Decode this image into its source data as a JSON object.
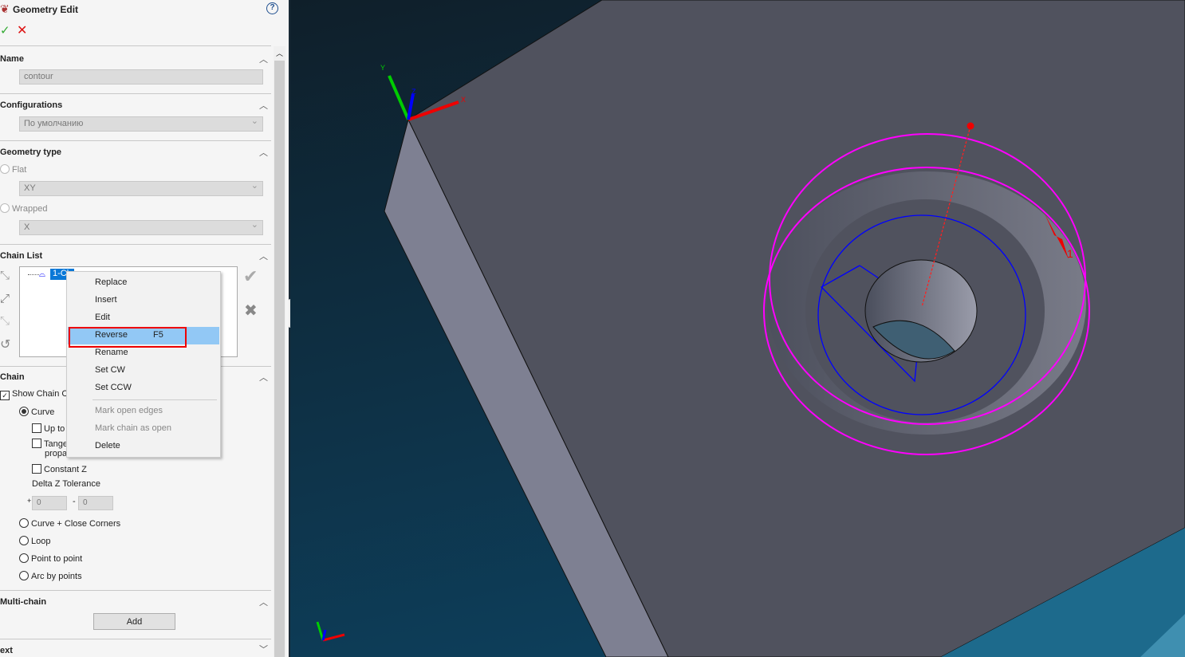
{
  "panel": {
    "title": "Geometry Edit",
    "help_icon": "question-icon",
    "name_section": {
      "label": "Name",
      "value": "contour"
    },
    "configurations": {
      "label": "Configurations",
      "value": "По умолчанию"
    },
    "geometry_type": {
      "label": "Geometry type",
      "flat": "Flat",
      "flat_plane": "XY",
      "wrapped": "Wrapped",
      "wrapped_axis": "X"
    },
    "chain_list": {
      "label": "Chain List",
      "item": "1-Ch"
    },
    "chain": {
      "label": "Chain",
      "show_chain": "Show Chain C",
      "curve": "Curve",
      "up_to": "Up to",
      "tangent": "Tange",
      "propagate": "propa",
      "constant_z": "Constant Z",
      "delta_z": "Delta Z Tolerance",
      "plus_value": "0",
      "minus_value": "0",
      "plus_sign": "+",
      "minus_sign": "-",
      "curve_close": "Curve + Close Corners",
      "loop": "Loop",
      "point_to_point": "Point to point",
      "arc_by_points": "Arc by points"
    },
    "multi_chain": {
      "label": "Multi-chain",
      "add": "Add"
    },
    "text_section": {
      "label": "ext"
    }
  },
  "context_menu": {
    "items": [
      {
        "label": "Replace"
      },
      {
        "label": "Insert"
      },
      {
        "label": "Edit"
      },
      {
        "label": "Reverse",
        "shortcut": "F5",
        "highlighted": true
      },
      {
        "label": "Rename"
      },
      {
        "label": "Set CW"
      },
      {
        "label": "Set CCW"
      },
      {
        "label": "Mark open edges",
        "disabled": true
      },
      {
        "label": "Mark chain as open",
        "disabled": true
      },
      {
        "label": "Delete"
      }
    ]
  },
  "viewport": {
    "axis_x": "X",
    "axis_y": "Y",
    "axis_z": "Z",
    "chain_marker": "1",
    "colors": {
      "chain": "#ff00ff",
      "tool": "#0000ff",
      "highlight": "#ff0000"
    }
  }
}
